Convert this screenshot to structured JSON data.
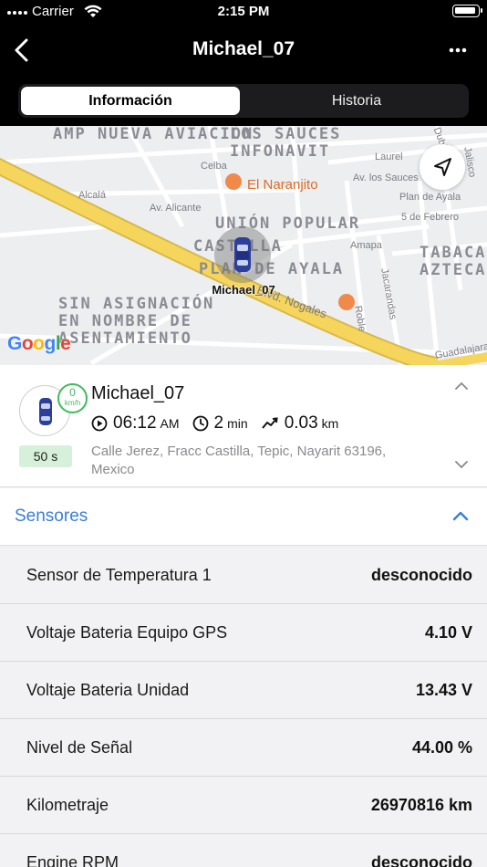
{
  "status_bar": {
    "carrier": "Carrier",
    "time": "2:15 PM"
  },
  "header": {
    "title": "Michael_07"
  },
  "tabs": [
    {
      "label": "Información",
      "active": true
    },
    {
      "label": "Historia",
      "active": false
    }
  ],
  "map": {
    "areas": [
      "AMP NUEVA AVIACIÓN",
      "LOS SAUCES INFONAVIT",
      "UNIÓN POPULAR",
      "CASTILLA",
      "PLAN DE AYALA",
      "SIN ASIGNACIÓN EN NOMBRE DE ASENTAMIENTO",
      "TABACALERA AZTECA"
    ],
    "streets": [
      "Celba",
      "Alcalá",
      "Av. Alicante",
      "Laurel",
      "Av. los Sauces",
      "Plan de Ayala",
      "5 de Febrero",
      "Amapa",
      "Jacarandas",
      "Roble",
      "Jalisco",
      "Dublín",
      "Blvd. Nogales",
      "Guadalajara"
    ],
    "poi": "El Naranjito",
    "vehicle_label": "Michael_07",
    "attribution": "Google"
  },
  "vehicle": {
    "name": "Michael_07",
    "speed_value": "0",
    "speed_unit": "km/h",
    "age": "50 s",
    "time_value": "06:12",
    "time_suffix": "AM",
    "duration_value": "2",
    "duration_unit": "min",
    "distance_value": "0.03",
    "distance_unit": "km",
    "address": "Calle Jerez, Fracc Castilla, Tepic, Nayarit 63196, Mexico"
  },
  "sensors": {
    "title": "Sensores",
    "items": [
      {
        "label": "Sensor de Temperatura 1",
        "value": "desconocido"
      },
      {
        "label": "Voltaje Bateria Equipo GPS",
        "value": "4.10 V"
      },
      {
        "label": "Voltaje Bateria Unidad",
        "value": "13.43 V"
      },
      {
        "label": "Nivel de Señal",
        "value": "44.00 %"
      },
      {
        "label": "Kilometraje",
        "value": "26970816 km"
      },
      {
        "label": "Engine RPM",
        "value": "desconocido"
      }
    ]
  },
  "colors": {
    "accent": "#3a7fd8",
    "speed_green": "#3dbb5a",
    "age_bg": "#d7f0d9",
    "road_yellow": "#f6d55c",
    "poi_orange": "#e06b26"
  }
}
